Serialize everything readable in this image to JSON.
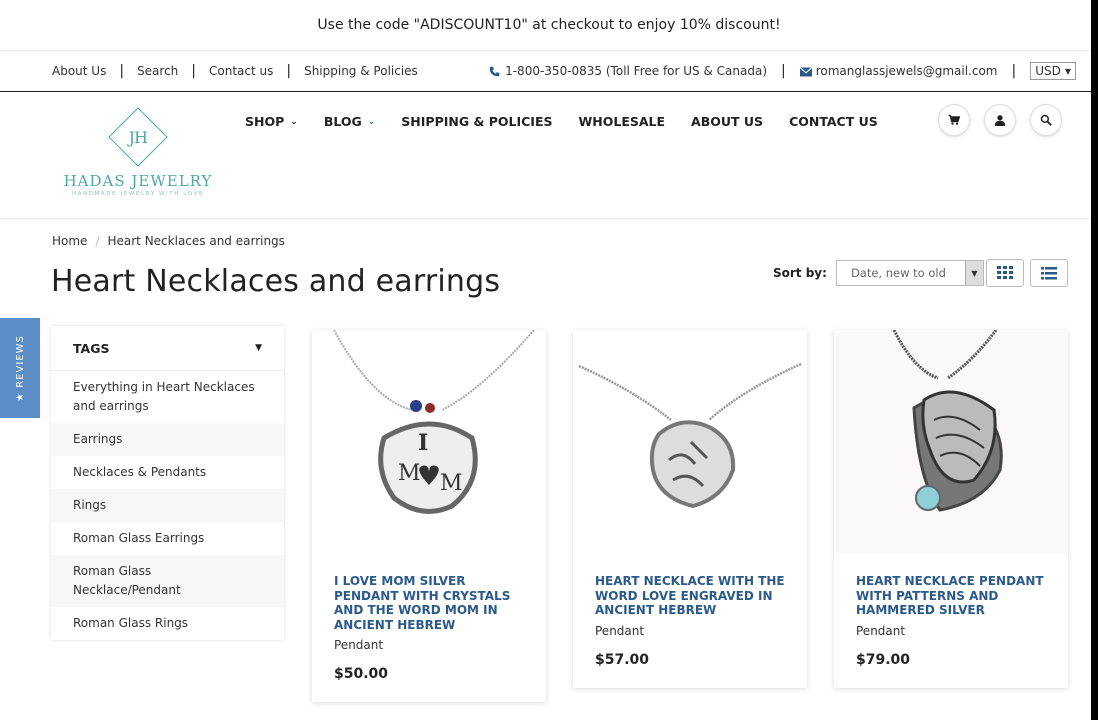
{
  "announcement": "Use the code \"ADISCOUNT10\" at checkout to enjoy 10% discount!",
  "topbar": {
    "links": [
      "About Us",
      "Search",
      "Contact us",
      "Shipping & Policies"
    ],
    "phone": "1-800-350-0835 (Toll Free for US & Canada)",
    "email": "romanglassjewels@gmail.com",
    "currency": "USD"
  },
  "logo": {
    "mark": "JH",
    "name": "HADAS JEWELRY",
    "tagline": "HANDMADE JEWELRY WITH LOVE"
  },
  "nav": {
    "shop": "SHOP",
    "blog": "BLOG",
    "shipping": "SHIPPING & POLICIES",
    "wholesale": "WHOLESALE",
    "about": "ABOUT US",
    "contact": "CONTACT US"
  },
  "breadcrumb": {
    "home": "Home",
    "current": "Heart Necklaces and earrings"
  },
  "page_title": "Heart Necklaces and earrings",
  "sort": {
    "label": "Sort by:",
    "value": "Date, new to old"
  },
  "reviews_tab": "★ REVIEWS",
  "tags": {
    "heading": "TAGS",
    "items": [
      "Everything in Heart Necklaces and earrings",
      "Earrings",
      "Necklaces & Pendants",
      "Rings",
      "Roman Glass Earrings",
      "Roman Glass Necklace/Pendant",
      "Roman Glass Rings"
    ]
  },
  "products": [
    {
      "title": "I LOVE MOM SILVER PENDANT WITH CRYSTALS AND THE WORD MOM IN ANCIENT HEBREW",
      "type": "Pendant",
      "price": "$50.00"
    },
    {
      "title": "HEART NECKLACE WITH THE WORD LOVE ENGRAVED IN ANCIENT HEBREW",
      "type": "Pendant",
      "price": "$57.00"
    },
    {
      "title": "HEART NECKLACE PENDANT WITH PATTERNS AND HAMMERED SILVER",
      "type": "Pendant",
      "price": "$79.00"
    }
  ],
  "colors": {
    "accent": "#4fa6a4",
    "product_title": "#2b5a8a",
    "reviews_tab": "#5b8ec7"
  }
}
